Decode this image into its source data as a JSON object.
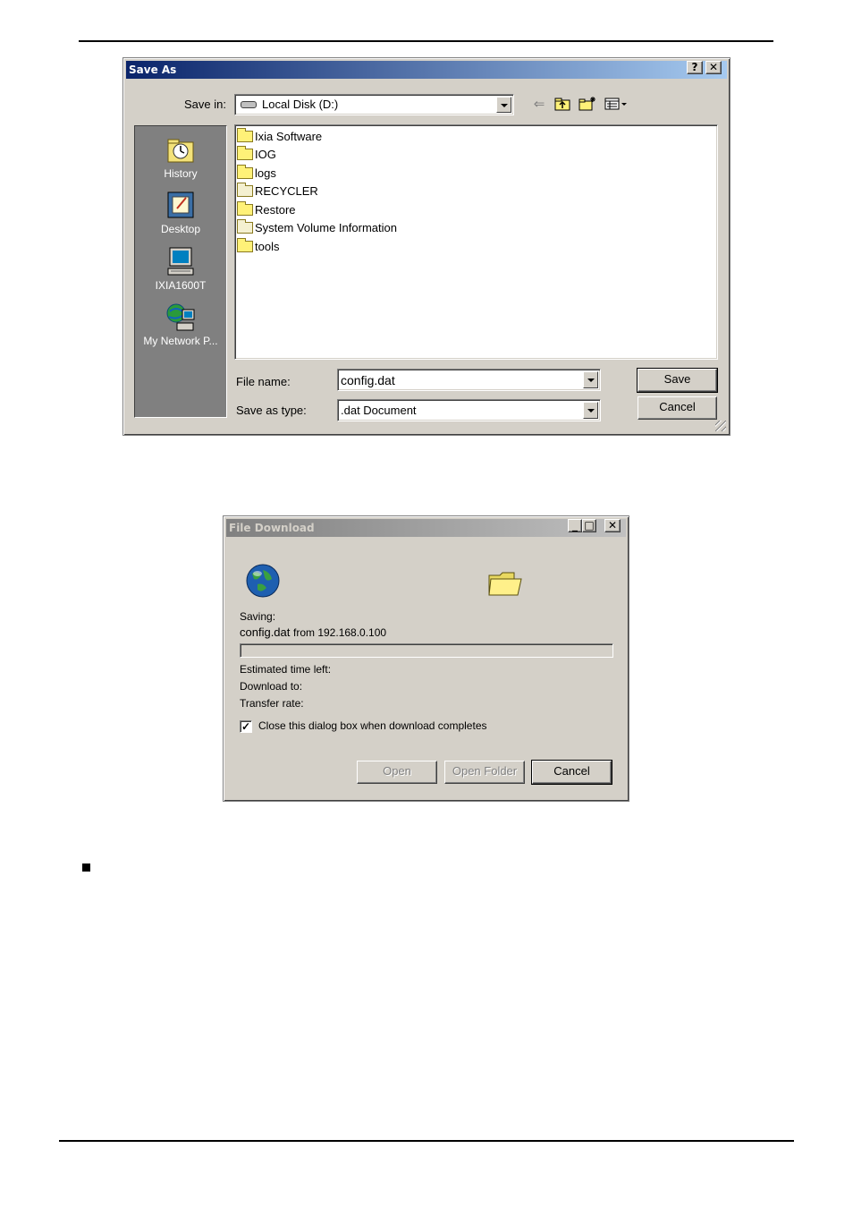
{
  "save_as": {
    "title": "Save As",
    "help_btn": "?",
    "close_btn": "✕",
    "save_in_label": "Save in:",
    "save_in_value": "Local Disk (D:)",
    "places": [
      "History",
      "Desktop",
      "IXIA1600T",
      "My Network P..."
    ],
    "files": [
      {
        "name": "Ixia Software",
        "type": "folder"
      },
      {
        "name": "IOG",
        "type": "folder"
      },
      {
        "name": "logs",
        "type": "folder"
      },
      {
        "name": "RECYCLER",
        "type": "system-folder"
      },
      {
        "name": "Restore",
        "type": "folder"
      },
      {
        "name": "System Volume Information",
        "type": "system-folder"
      },
      {
        "name": "tools",
        "type": "folder"
      }
    ],
    "file_name_label": "File name:",
    "file_name_value": "config.dat",
    "save_as_type_label": "Save as type:",
    "save_as_type_value": ".dat Document",
    "save_button": "Save",
    "cancel_button": "Cancel",
    "toolbar_icons": [
      "back-arrow-icon",
      "up-folder-icon",
      "new-folder-icon",
      "view-menu-icon"
    ]
  },
  "file_download": {
    "title": "File Download",
    "minimize_btn": "_",
    "maximize_btn": "□",
    "close_btn": "✕",
    "saving_label": "Saving:",
    "file_name": "config.dat",
    "from_text": "from 192.168.0.100",
    "progress": 0,
    "estimated_time_label": "Estimated time left:",
    "download_to_label": "Download to:",
    "transfer_rate_label": "Transfer rate:",
    "close_when_done_label": "Close this dialog box when download completes",
    "close_when_done_checked": true,
    "check_mark": "✓",
    "open_button": "Open",
    "open_folder_button": "Open Folder",
    "cancel_button": "Cancel"
  }
}
